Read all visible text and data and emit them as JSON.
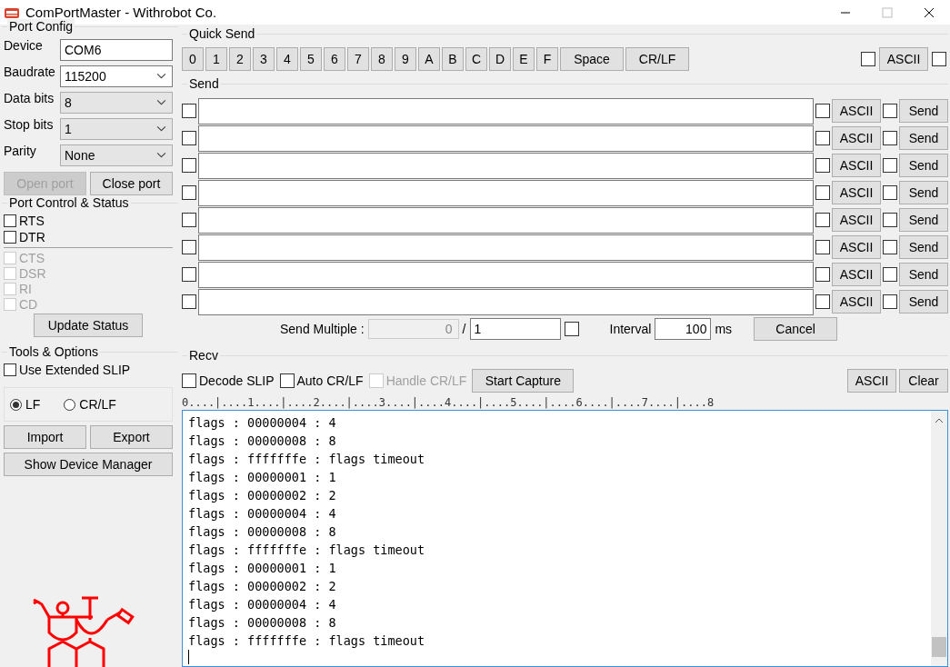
{
  "window": {
    "title": "ComPortMaster - Withrobot Co."
  },
  "port_config": {
    "title": "Port Config",
    "fields": [
      {
        "label": "Device",
        "value": "COM6",
        "kind": "text"
      },
      {
        "label": "Baudrate",
        "value": "115200",
        "kind": "combo"
      },
      {
        "label": "Data bits",
        "value": "8",
        "kind": "list"
      },
      {
        "label": "Stop bits",
        "value": "1",
        "kind": "list"
      },
      {
        "label": "Parity",
        "value": "None",
        "kind": "list"
      }
    ],
    "buttons": [
      {
        "label": "Open port",
        "disabled": true
      },
      {
        "label": "Close port",
        "disabled": false
      }
    ]
  },
  "port_control": {
    "title": "Port Control & Status",
    "controls": [
      {
        "label": "RTS",
        "checked": false,
        "disabled": false
      },
      {
        "label": "DTR",
        "checked": false,
        "disabled": false
      }
    ],
    "status": [
      {
        "label": "CTS",
        "checked": false,
        "disabled": true
      },
      {
        "label": "DSR",
        "checked": false,
        "disabled": true
      },
      {
        "label": "RI",
        "checked": false,
        "disabled": true
      },
      {
        "label": "CD",
        "checked": false,
        "disabled": true
      }
    ],
    "update_button": "Update Status"
  },
  "tools": {
    "title": "Tools & Options",
    "extended_slip": {
      "label": "Use Extended SLIP",
      "checked": false
    },
    "line_endings": [
      {
        "label": "LF",
        "selected": true
      },
      {
        "label": "CR/LF",
        "selected": false
      }
    ],
    "buttons": [
      "Import",
      "Export"
    ],
    "device_manager_button": "Show Device Manager"
  },
  "quick_send": {
    "title": "Quick Send",
    "keys": [
      "0",
      "1",
      "2",
      "3",
      "4",
      "5",
      "6",
      "7",
      "8",
      "9",
      "A",
      "B",
      "C",
      "D",
      "E",
      "F"
    ],
    "space": "Space",
    "crlf": "CR/LF",
    "checked_left": false,
    "ascii": "ASCII",
    "checked_right": false
  },
  "send": {
    "title": "Send",
    "rows": [
      {
        "checked": false,
        "ascii_checked": false,
        "ascii": "ASCII",
        "send_checked": false,
        "send": "Send"
      },
      {
        "checked": false,
        "ascii_checked": false,
        "ascii": "ASCII",
        "send_checked": false,
        "send": "Send"
      },
      {
        "checked": false,
        "ascii_checked": false,
        "ascii": "ASCII",
        "send_checked": false,
        "send": "Send"
      },
      {
        "checked": false,
        "ascii_checked": false,
        "ascii": "ASCII",
        "send_checked": false,
        "send": "Send"
      },
      {
        "checked": false,
        "ascii_checked": false,
        "ascii": "ASCII",
        "send_checked": false,
        "send": "Send"
      },
      {
        "checked": false,
        "ascii_checked": false,
        "ascii": "ASCII",
        "send_checked": false,
        "send": "Send"
      },
      {
        "checked": false,
        "ascii_checked": false,
        "ascii": "ASCII",
        "send_checked": false,
        "send": "Send"
      },
      {
        "checked": false,
        "ascii_checked": false,
        "ascii": "ASCII",
        "send_checked": false,
        "send": "Send"
      }
    ],
    "multiple": {
      "label": "Send Multiple :",
      "count": "0",
      "slash": "/",
      "total": "1",
      "checked": false,
      "interval_label": "Interval",
      "interval": "100",
      "unit": "ms",
      "cancel": "Cancel"
    }
  },
  "recv": {
    "title": "Recv",
    "options": [
      {
        "label": "Decode SLIP",
        "checked": false,
        "disabled": false
      },
      {
        "label": "Auto CR/LF",
        "checked": false,
        "disabled": false
      },
      {
        "label": "Handle CR/LF",
        "checked": false,
        "disabled": true
      }
    ],
    "capture": "Start Capture",
    "ascii": "ASCII",
    "clear": "Clear",
    "ruler": "0....|....1....|....2....|....3....|....4....|....5....|....6....|....7....|....8",
    "lines": [
      "flags : 00000004 : 4",
      "flags : 00000008 : 8",
      "flags : fffffffe : flags timeout",
      "flags : 00000001 : 1",
      "flags : 00000002 : 2",
      "flags : 00000004 : 4",
      "flags : 00000008 : 8",
      "flags : fffffffe : flags timeout",
      "flags : 00000001 : 1",
      "flags : 00000002 : 2",
      "flags : 00000004 : 4",
      "flags : 00000008 : 8",
      "flags : fffffffe : flags timeout"
    ]
  }
}
